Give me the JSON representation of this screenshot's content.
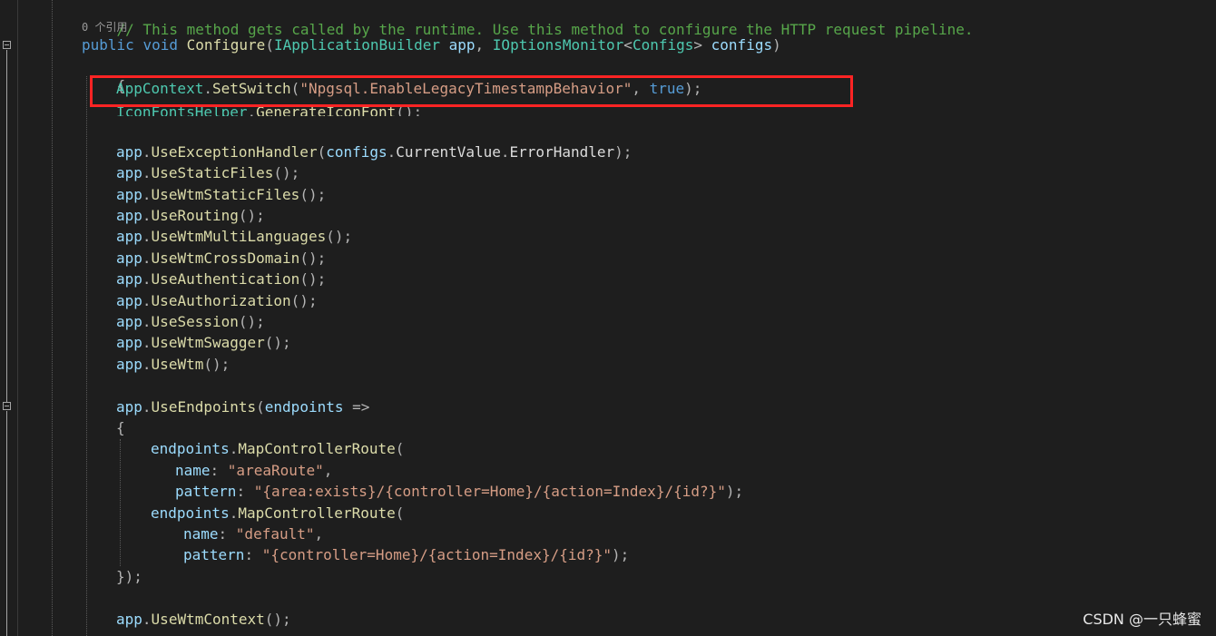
{
  "code": {
    "comment_line": "// This method gets called by the runtime. Use this method to configure the HTTP request pipeline.",
    "codelens": "0 个引用",
    "signature": {
      "kw_public": "public",
      "kw_void": "void",
      "method": "Configure",
      "open": "(",
      "type1": "IApplicationBuilder",
      "param1": "app",
      "comma": ", ",
      "type2": "IOptionsMonitor",
      "lt": "<",
      "type3": "Configs",
      "gt": ">",
      "param2": "configs",
      "close": ")"
    },
    "open_brace": "{",
    "setswitch": {
      "cls": "AppContext",
      "dot": ".",
      "method": "SetSwitch",
      "open": "(",
      "str": "\"Npgsql.EnableLegacyTimestampBehavior\"",
      "comma": ", ",
      "val": "true",
      "close": ");"
    },
    "iconfont": {
      "cls": "IconFontsHelper",
      "dot": ".",
      "method": "GenerateIconFont",
      "tail": "();"
    },
    "exception_handler": {
      "obj": "app",
      "method": "UseExceptionHandler",
      "open": "(",
      "arg1": "configs",
      "arg2": "CurrentValue",
      "arg3": "ErrorHandler",
      "close": ");"
    },
    "app_calls": [
      {
        "obj": "app",
        "method": "UseStaticFiles",
        "tail": "();"
      },
      {
        "obj": "app",
        "method": "UseWtmStaticFiles",
        "tail": "();"
      },
      {
        "obj": "app",
        "method": "UseRouting",
        "tail": "();"
      },
      {
        "obj": "app",
        "method": "UseWtmMultiLanguages",
        "tail": "();"
      },
      {
        "obj": "app",
        "method": "UseWtmCrossDomain",
        "tail": "();"
      },
      {
        "obj": "app",
        "method": "UseAuthentication",
        "tail": "();"
      },
      {
        "obj": "app",
        "method": "UseAuthorization",
        "tail": "();"
      },
      {
        "obj": "app",
        "method": "UseSession",
        "tail": "();"
      },
      {
        "obj": "app",
        "method": "UseWtmSwagger",
        "tail": "();"
      },
      {
        "obj": "app",
        "method": "UseWtm",
        "tail": "();"
      }
    ],
    "endpoints_line": {
      "obj": "app",
      "method": "UseEndpoints",
      "open": "(",
      "param": "endpoints",
      "arrow": " =>"
    },
    "inner_open": "{",
    "route1": {
      "obj": "endpoints",
      "method": "MapControllerRoute",
      "open": "(",
      "name_label": "name",
      "name_value": "\"areaRoute\"",
      "name_tail": ",",
      "pattern_label": "pattern",
      "pattern_value": "\"{area:exists}/{controller=Home}/{action=Index}/{id?}\"",
      "pattern_tail": ");"
    },
    "route2": {
      "obj": "endpoints",
      "method": "MapControllerRoute",
      "open": "(",
      "name_label": "name",
      "name_value": "\"default\"",
      "name_tail": ",",
      "pattern_label": "pattern",
      "pattern_value": "\"{controller=Home}/{action=Index}/{id?}\"",
      "pattern_tail": ");"
    },
    "inner_close": "});",
    "last_call": {
      "obj": "app",
      "method": "UseWtmContext",
      "tail": "();"
    },
    "colon": ": "
  },
  "watermark": "CSDN @一只蜂蜜",
  "colors": {
    "background": "#1e1e1e",
    "comment": "#57a64a",
    "keyword": "#569cd6",
    "type": "#4ec9b0",
    "method": "#dcdcaa",
    "parameter": "#9cdcfe",
    "string": "#d69d85",
    "highlight_box": "#ff2424"
  }
}
